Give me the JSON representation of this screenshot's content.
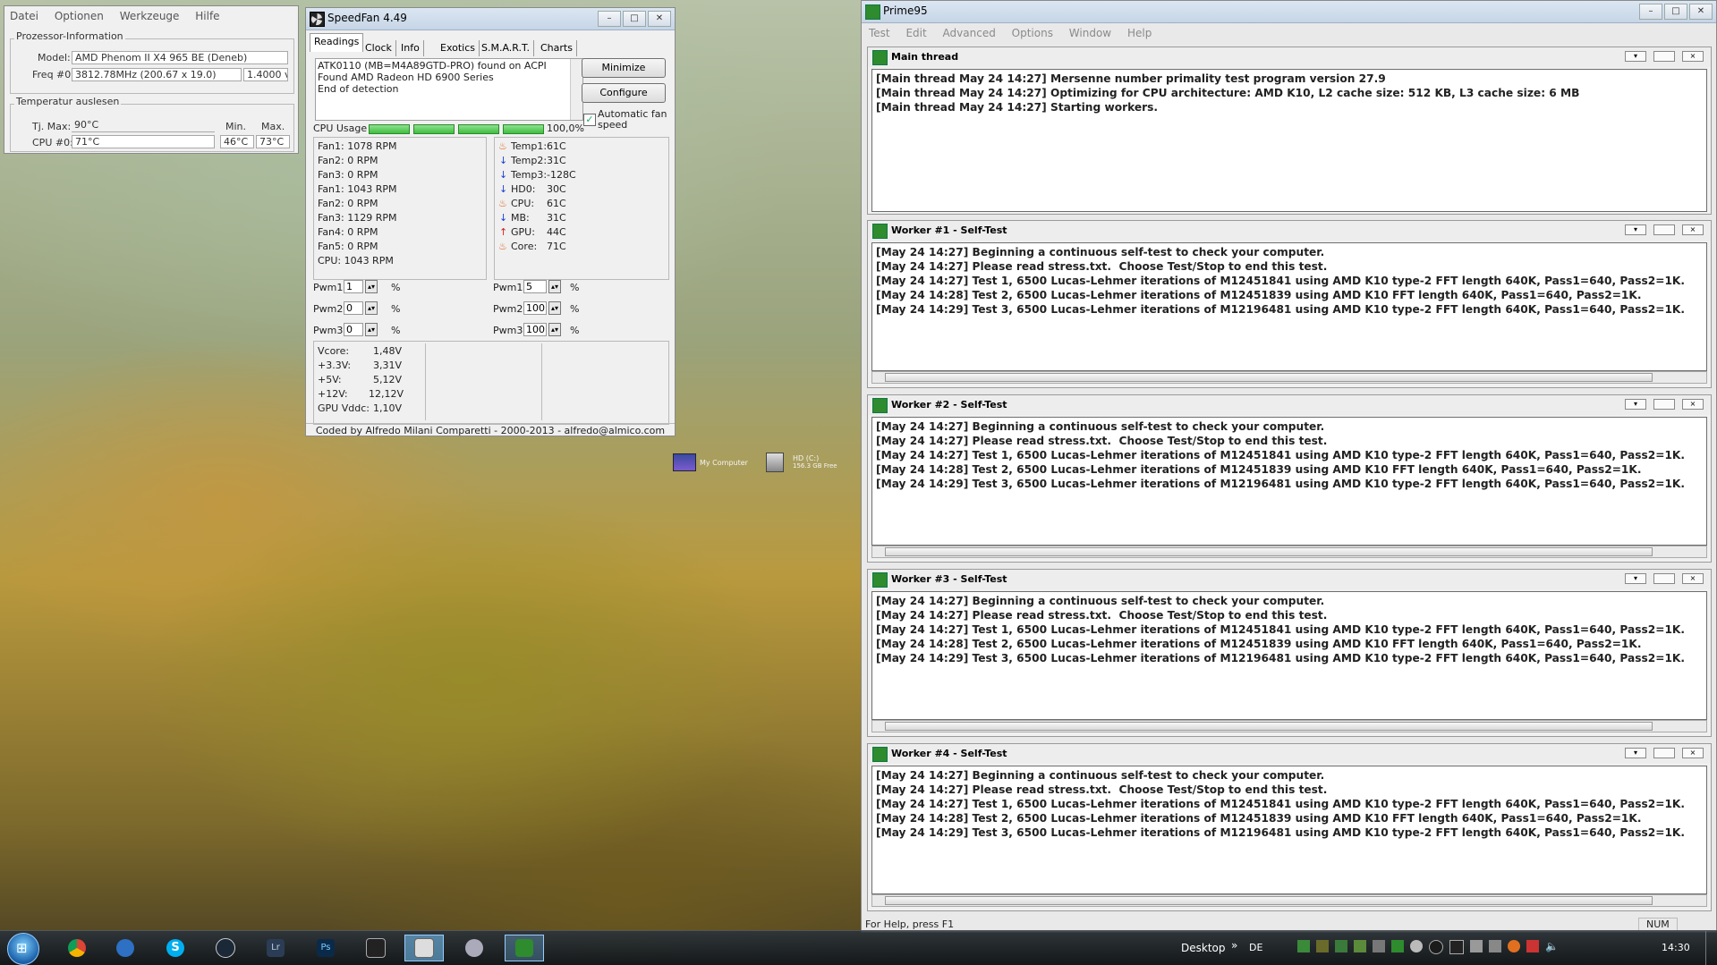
{
  "cpuinfo": {
    "menu": [
      "Datei",
      "Optionen",
      "Werkzeuge",
      "Hilfe"
    ],
    "processor_group": "Prozessor-Information",
    "model_label": "Model:",
    "model_value": "AMD Phenom II X4 965 BE (Deneb)",
    "freq_label": "Freq #0:",
    "freq_value": "3812.78MHz (200.67 x 19.0)",
    "voltage_value": "1.4000 v",
    "temp_group": "Temperatur auslesen",
    "tjmax_label": "Tj. Max:",
    "tjmax_value": "90°C",
    "min_label": "Min.",
    "max_label": "Max.",
    "cpu0_label": "CPU #0:",
    "cpu0_value": "71°C",
    "cpu0_min": "46°C",
    "cpu0_max": "73°C"
  },
  "speedfan": {
    "title": "SpeedFan 4.49",
    "tabs": [
      "Readings",
      "Clock",
      "Info",
      "Exotics",
      "S.M.A.R.T.",
      "Charts"
    ],
    "log_lines": [
      "ATK0110 (MB=M4A89GTD-PRO) found on ACPI",
      "Found AMD Radeon HD 6900 Series",
      "End of detection"
    ],
    "minimize_label": "Minimize",
    "configure_label": "Configure",
    "auto_fan_label": "Automatic fan speed",
    "cpu_usage_label": "CPU Usage",
    "cpu_usage_value": "100,0%",
    "fans": [
      "Fan1: 1078 RPM",
      "Fan2: 0 RPM",
      "Fan3: 0 RPM",
      "Fan1: 1043 RPM",
      "Fan2: 0 RPM",
      "Fan3: 1129 RPM",
      "Fan4: 0 RPM",
      "Fan5: 0 RPM",
      "CPU: 1043 RPM"
    ],
    "temps": [
      {
        "label": "Temp1:",
        "value": "61C",
        "icon": "flame"
      },
      {
        "label": "Temp2:",
        "value": "31C",
        "icon": "down"
      },
      {
        "label": "Temp3:",
        "value": "-128C",
        "icon": "down"
      },
      {
        "label": "HD0:",
        "value": "30C",
        "icon": "down"
      },
      {
        "label": "CPU:",
        "value": "61C",
        "icon": "flame"
      },
      {
        "label": "MB:",
        "value": "31C",
        "icon": "down"
      },
      {
        "label": "GPU:",
        "value": "44C",
        "icon": "up"
      },
      {
        "label": "Core:",
        "value": "71C",
        "icon": "flame"
      }
    ],
    "pwm_left": [
      {
        "label": "Pwm1:",
        "value": "1"
      },
      {
        "label": "Pwm2:",
        "value": "0"
      },
      {
        "label": "Pwm3:",
        "value": "0"
      }
    ],
    "pwm_right": [
      {
        "label": "Pwm1:",
        "value": "5"
      },
      {
        "label": "Pwm2:",
        "value": "100"
      },
      {
        "label": "Pwm3:",
        "value": "100"
      }
    ],
    "pct": "%",
    "voltages": [
      {
        "label": "Vcore:",
        "value": "1,48V"
      },
      {
        "label": "+3.3V:",
        "value": "3,31V"
      },
      {
        "label": "+5V:",
        "value": "5,12V"
      },
      {
        "label": "+12V:",
        "value": "12,12V"
      },
      {
        "label": "GPU Vddc:",
        "value": "1,10V"
      }
    ],
    "footer": "Coded by Alfredo Milani Comparetti - 2000-2013 - alfredo@almico.com"
  },
  "desktop": {
    "icon1_label": "My Computer",
    "icon2_label": "HD (C:)",
    "icon2_sub": "156.3 GB Free"
  },
  "prime95": {
    "title": "Prime95",
    "menu": [
      "Test",
      "Edit",
      "Advanced",
      "Options",
      "Window",
      "Help"
    ],
    "main_title": "Main thread",
    "main_log": "[Main thread May 24 14:27] Mersenne number primality test program version 27.9\n[Main thread May 24 14:27] Optimizing for CPU architecture: AMD K10, L2 cache size: 512 KB, L3 cache size: 6 MB\n[Main thread May 24 14:27] Starting workers.",
    "workers": [
      {
        "title": "Worker #1 - Self-Test",
        "log": "[May 24 14:27] Beginning a continuous self-test to check your computer.\n[May 24 14:27] Please read stress.txt.  Choose Test/Stop to end this test.\n[May 24 14:27] Test 1, 6500 Lucas-Lehmer iterations of M12451841 using AMD K10 type-2 FFT length 640K, Pass1=640, Pass2=1K.\n[May 24 14:28] Test 2, 6500 Lucas-Lehmer iterations of M12451839 using AMD K10 FFT length 640K, Pass1=640, Pass2=1K.\n[May 24 14:29] Test 3, 6500 Lucas-Lehmer iterations of M12196481 using AMD K10 type-2 FFT length 640K, Pass1=640, Pass2=1K."
      },
      {
        "title": "Worker #2 - Self-Test",
        "log": "[May 24 14:27] Beginning a continuous self-test to check your computer.\n[May 24 14:27] Please read stress.txt.  Choose Test/Stop to end this test.\n[May 24 14:27] Test 1, 6500 Lucas-Lehmer iterations of M12451841 using AMD K10 type-2 FFT length 640K, Pass1=640, Pass2=1K.\n[May 24 14:28] Test 2, 6500 Lucas-Lehmer iterations of M12451839 using AMD K10 FFT length 640K, Pass1=640, Pass2=1K.\n[May 24 14:29] Test 3, 6500 Lucas-Lehmer iterations of M12196481 using AMD K10 type-2 FFT length 640K, Pass1=640, Pass2=1K."
      },
      {
        "title": "Worker #3 - Self-Test",
        "log": "[May 24 14:27] Beginning a continuous self-test to check your computer.\n[May 24 14:27] Please read stress.txt.  Choose Test/Stop to end this test.\n[May 24 14:27] Test 1, 6500 Lucas-Lehmer iterations of M12451841 using AMD K10 type-2 FFT length 640K, Pass1=640, Pass2=1K.\n[May 24 14:28] Test 2, 6500 Lucas-Lehmer iterations of M12451839 using AMD K10 FFT length 640K, Pass1=640, Pass2=1K.\n[May 24 14:29] Test 3, 6500 Lucas-Lehmer iterations of M12196481 using AMD K10 type-2 FFT length 640K, Pass1=640, Pass2=1K."
      },
      {
        "title": "Worker #4 - Self-Test",
        "log": "[May 24 14:27] Beginning a continuous self-test to check your computer.\n[May 24 14:27] Please read stress.txt.  Choose Test/Stop to end this test.\n[May 24 14:27] Test 1, 6500 Lucas-Lehmer iterations of M12451841 using AMD K10 type-2 FFT length 640K, Pass1=640, Pass2=1K.\n[May 24 14:28] Test 2, 6500 Lucas-Lehmer iterations of M12451839 using AMD K10 FFT length 640K, Pass1=640, Pass2=1K.\n[May 24 14:29] Test 3, 6500 Lucas-Lehmer iterations of M12196481 using AMD K10 type-2 FFT length 640K, Pass1=640, Pass2=1K."
      }
    ],
    "status_text": "For Help, press F1",
    "status_num": "NUM"
  },
  "taskbar": {
    "desktop_label": "Desktop",
    "lang": "DE",
    "clock": "14:30",
    "icons": [
      "chrome-icon",
      "teamspeak-icon",
      "skype-icon",
      "steam-icon",
      "lightroom-icon",
      "photoshop-icon",
      "speedfan-icon",
      "cpuz-icon",
      "program-icon",
      "prime95-icon"
    ]
  },
  "colors": {
    "green_bar": "#3fbf3f",
    "prime_icon": "#2e8b2e",
    "taskbar_active": "#78c8ff"
  }
}
